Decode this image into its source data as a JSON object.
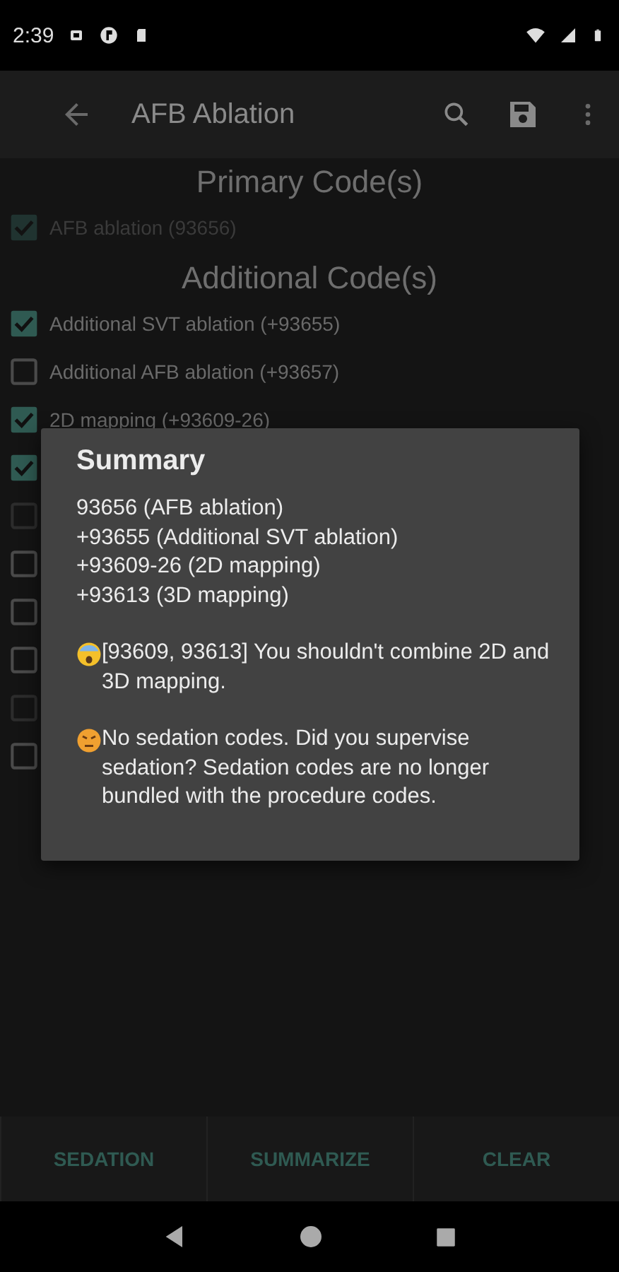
{
  "status_bar": {
    "time": "2:39"
  },
  "app_bar": {
    "title": "AFB Ablation"
  },
  "primary": {
    "heading": "Primary Code(s)",
    "items": [
      {
        "label": "AFB ablation (93656)",
        "checked": true,
        "disabled": true
      }
    ]
  },
  "additional": {
    "heading": "Additional Code(s)",
    "items": [
      {
        "label": "Additional SVT ablation (+93655)",
        "checked": true,
        "disabled": false
      },
      {
        "label": "Additional AFB ablation (+93657)",
        "checked": false,
        "disabled": false
      },
      {
        "label": "2D mapping (+93609-26)",
        "checked": true,
        "disabled": false
      },
      {
        "checked": true,
        "disabled": false
      },
      {
        "checked": false,
        "disabled": true
      },
      {
        "checked": false,
        "disabled": false
      },
      {
        "checked": false,
        "disabled": false
      },
      {
        "checked": false,
        "disabled": false
      },
      {
        "checked": false,
        "disabled": true
      },
      {
        "checked": false,
        "disabled": false
      }
    ]
  },
  "dialog": {
    "title": "Summary",
    "codes": [
      "93656 (AFB ablation)",
      "+93655 (Additional SVT ablation)",
      "+93609-26 (2D mapping)",
      "+93613 (3D mapping)"
    ],
    "messages": [
      {
        "kind": "scream",
        "text": "[93609, 93613] You shouldn't combine 2D and 3D mapping."
      },
      {
        "kind": "angry",
        "text": "No sedation codes. Did you supervise sedation? Sedation codes are no longer bundled with the procedure codes."
      }
    ]
  },
  "bottom_buttons": [
    "SEDATION",
    "SUMMARIZE",
    "CLEAR"
  ]
}
